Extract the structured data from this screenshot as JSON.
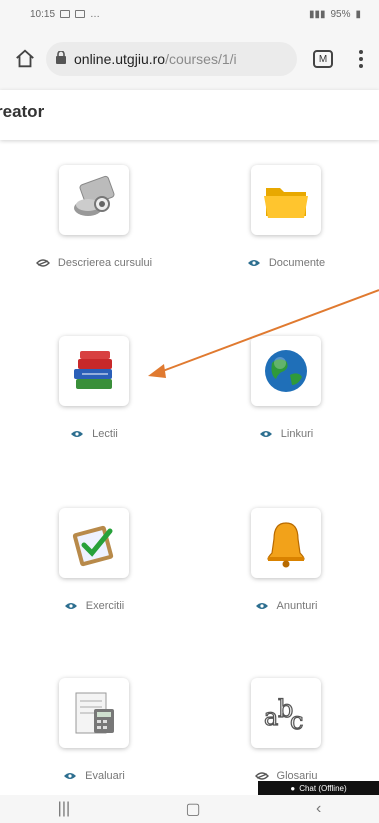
{
  "status": {
    "time": "10:15",
    "battery": "95%"
  },
  "browser": {
    "url_host": "online.utgjiu.ro",
    "url_path": "/courses/1/i",
    "tab_count": "M"
  },
  "header": {
    "title": "reator"
  },
  "tiles": [
    {
      "label": "Descrierea cursului",
      "icon": "course-description-icon",
      "visible": false
    },
    {
      "label": "Documente",
      "icon": "folder-icon",
      "visible": true
    },
    {
      "label": "Lectii",
      "icon": "books-icon",
      "visible": true
    },
    {
      "label": "Linkuri",
      "icon": "globe-icon",
      "visible": true
    },
    {
      "label": "Exercitii",
      "icon": "clipboard-check-icon",
      "visible": true
    },
    {
      "label": "Anunturi",
      "icon": "bell-icon",
      "visible": true
    },
    {
      "label": "Evaluari",
      "icon": "calculator-icon",
      "visible": true
    },
    {
      "label": "Glosariu",
      "icon": "abc-glossary-icon",
      "visible": false
    }
  ],
  "annotation": {
    "arrow_color": "#e07a30"
  },
  "chat": {
    "label": "Chat (Offline)"
  },
  "colors": {
    "eye_visible": "#2c6e8f",
    "eye_hidden": "#555555"
  }
}
